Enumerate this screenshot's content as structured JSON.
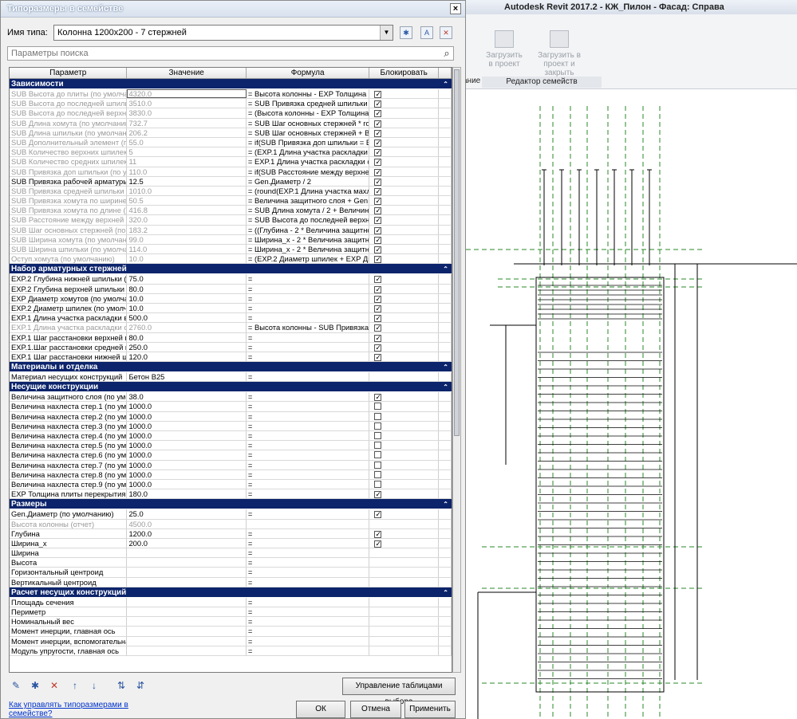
{
  "dialog": {
    "title": "Типоразмеры в семействе",
    "close": "×",
    "type_name_label": "Имя типа:",
    "type_name_value": "Колонна 1200х200 - 7 стержней",
    "search_placeholder": "Параметры поиска",
    "columns": [
      "Параметр",
      "Значение",
      "Формула",
      "Блокировать"
    ],
    "groups": [
      {
        "name": "Зависимости",
        "rows": [
          {
            "p": "SUB Высота до плиты (по умолчан",
            "v": "4320.0",
            "f": "= Высота колонны - EXP Толщина пл",
            "lock": "checked",
            "dim": true,
            "edit": true
          },
          {
            "p": "SUB Высота до последней  шпильк",
            "v": "3510.0",
            "f": "= SUB Привязка средней шпильки +",
            "lock": "checked",
            "dim": true
          },
          {
            "p": "SUB Высота до последней верхней",
            "v": "3830.0",
            "f": "= (Высота колонны - EXP Толщина пл",
            "lock": "checked",
            "dim": true
          },
          {
            "p": "SUB Длина хомута (по умолчанию)",
            "v": "732.7",
            "f": "= SUB Шаг основных стержней * rou",
            "lock": "checked",
            "dim": true
          },
          {
            "p": "SUB Длина шпильки (по умолчани",
            "v": "206.2",
            "f": "= SUB Шаг основных стержней + Вел",
            "lock": "checked",
            "dim": true
          },
          {
            "p": "SUB Дополнительный элемент (по",
            "v": "55.0",
            "f": "= if(SUB Привязка доп шпильки = EX",
            "lock": "checked",
            "dim": true
          },
          {
            "p": "SUB Количество верхних шпилек (",
            "v": "5",
            "f": "= (EXP.1 Длина участка раскладки в",
            "lock": "checked",
            "dim": true
          },
          {
            "p": "SUB Количество средних шпилек (",
            "v": "11",
            "f": "= EXP.1 Длина участка раскладки ср",
            "lock": "checked",
            "dim": true
          },
          {
            "p": "SUB Привязка доп шпильки (по умо",
            "v": "110.0",
            "f": "= if(SUB Расстояние между верхней",
            "lock": "checked",
            "dim": true
          },
          {
            "p": "SUB Привязка рабочей арматуры (",
            "v": "12.5",
            "f": "= Gen.Диаметр / 2",
            "lock": "checked",
            "dim": false
          },
          {
            "p": "SUB Привязка средней шпильки (п",
            "v": "1010.0",
            "f": "= (round(EXP.1 Длина участка махле",
            "lock": "checked",
            "dim": true
          },
          {
            "p": "SUB Привязка хомута по ширине (п",
            "v": "50.5",
            "f": "= Величина защитного слоя + Gen.Д",
            "lock": "checked",
            "dim": true
          },
          {
            "p": "SUB Привязка хомута по длине (по",
            "v": "416.8",
            "f": "= SUB Длина хомута / 2 + Величина з",
            "lock": "checked",
            "dim": true
          },
          {
            "p": "SUB Расстояние между верхней и с",
            "v": "320.0",
            "f": "= SUB Высота до последней верхней",
            "lock": "checked",
            "dim": true
          },
          {
            "p": "SUB Шаг основных стержней (по у",
            "v": "183.2",
            "f": "= ((Глубина - 2 * Величина защитног",
            "lock": "checked",
            "dim": true
          },
          {
            "p": "SUB Ширина хомута (по умолчани",
            "v": "99.0",
            "f": "= Ширина_х - 2 * Величина защитно",
            "lock": "checked",
            "dim": true
          },
          {
            "p": "SUB Ширина шпильки (по умолчан",
            "v": "114.0",
            "f": "= Ширина_х - 2 * Величина защитно",
            "lock": "checked",
            "dim": true
          },
          {
            "p": "Оступ.хомута (по умолчанию)",
            "v": "10.0",
            "f": "= (EXP.2 Диаметр шпилек + EXP Диа",
            "lock": "checked",
            "dim": true
          }
        ]
      },
      {
        "name": "Набор арматурных стержней",
        "rows": [
          {
            "p": "EXP.2 Глубина нижней шпильки (п",
            "v": "75.0",
            "f": "=",
            "lock": "checked",
            "dim": false
          },
          {
            "p": "EXP.2 Глубина верхней шпильки (п",
            "v": "80.0",
            "f": "=",
            "lock": "checked",
            "dim": false
          },
          {
            "p": "EXP Диаметр хомутов (по умолчан",
            "v": "10.0",
            "f": "=",
            "lock": "checked",
            "dim": false
          },
          {
            "p": "EXP.2 Диаметр шпилек (по умолча",
            "v": "10.0",
            "f": "=",
            "lock": "checked",
            "dim": false
          },
          {
            "p": "EXP.1 Длина участка раскладки ве",
            "v": "500.0",
            "f": "=",
            "lock": "checked",
            "dim": false
          },
          {
            "p": "EXP.1 Длина участка раскладки ср",
            "v": "2760.0",
            "f": "= Высота колонны - SUB Привязка ср",
            "lock": "checked",
            "dim": true
          },
          {
            "p": "EXP.1 Шаг расстановки верхней ш",
            "v": "80.0",
            "f": "=",
            "lock": "checked",
            "dim": false
          },
          {
            "p": "EXP.1.Шаг расстановки средней ш",
            "v": "250.0",
            "f": "=",
            "lock": "checked",
            "dim": false
          },
          {
            "p": "EXP.1 Шаг расстановки нижней шп",
            "v": "120.0",
            "f": "=",
            "lock": "checked",
            "dim": false
          }
        ]
      },
      {
        "name": "Материалы и отделка",
        "rows": [
          {
            "p": "Материал несущих конструкций",
            "v": "Бетон B25",
            "f": "=",
            "lock": "none",
            "dim": false
          }
        ]
      },
      {
        "name": "Несущие конструкции",
        "rows": [
          {
            "p": "Величина защитного слоя (по умол",
            "v": "38.0",
            "f": "=",
            "lock": "checked",
            "dim": false
          },
          {
            "p": "Величина нахлеста стер.1 (по умо",
            "v": "1000.0",
            "f": "=",
            "lock": "empty",
            "dim": false
          },
          {
            "p": "Величина нахлеста стер.2 (по умо",
            "v": "1000.0",
            "f": "=",
            "lock": "empty",
            "dim": false
          },
          {
            "p": "Величина нахлеста стер.3 (по умо",
            "v": "1000.0",
            "f": "=",
            "lock": "empty",
            "dim": false
          },
          {
            "p": "Величина нахлеста стер.4 (по умо",
            "v": "1000.0",
            "f": "=",
            "lock": "empty",
            "dim": false
          },
          {
            "p": "Величина нахлеста стер.5 (по умо",
            "v": "1000.0",
            "f": "=",
            "lock": "empty",
            "dim": false
          },
          {
            "p": "Величина нахлеста стер.6 (по умо",
            "v": "1000.0",
            "f": "=",
            "lock": "empty",
            "dim": false
          },
          {
            "p": "Величина нахлеста стер.7 (по умо",
            "v": "1000.0",
            "f": "=",
            "lock": "empty",
            "dim": false
          },
          {
            "p": "Величина нахлеста стер.8 (по умо",
            "v": "1000.0",
            "f": "=",
            "lock": "empty",
            "dim": false
          },
          {
            "p": "Величина нахлеста стер.9 (по умо",
            "v": "1000.0",
            "f": "=",
            "lock": "empty",
            "dim": false
          },
          {
            "p": "EXP Толщина плиты перекрытия (п",
            "v": "180.0",
            "f": "=",
            "lock": "checked",
            "dim": false
          }
        ]
      },
      {
        "name": "Размеры",
        "rows": [
          {
            "p": "Gen.Диаметр (по умолчанию)",
            "v": "25.0",
            "f": "=",
            "lock": "checked",
            "dim": false
          },
          {
            "p": "Высота колонны (отчет)",
            "v": "4500.0",
            "f": "",
            "lock": "none",
            "dim": true
          },
          {
            "p": "Глубина",
            "v": "1200.0",
            "f": "=",
            "lock": "checked",
            "dim": false
          },
          {
            "p": "Ширина_х",
            "v": "200.0",
            "f": "=",
            "lock": "checked",
            "dim": false
          },
          {
            "p": "Ширина",
            "v": "",
            "f": "=",
            "lock": "none",
            "dim": false
          },
          {
            "p": "Высота",
            "v": "",
            "f": "=",
            "lock": "none",
            "dim": false
          },
          {
            "p": "Горизонтальный центроид",
            "v": "",
            "f": "=",
            "lock": "none",
            "dim": false
          },
          {
            "p": "Вертикальный центроид",
            "v": "",
            "f": "=",
            "lock": "none",
            "dim": false
          }
        ]
      },
      {
        "name": "Расчет несущих конструкций",
        "rows": [
          {
            "p": "Площадь сечения",
            "v": "",
            "f": "=",
            "lock": "none",
            "dim": false
          },
          {
            "p": "Периметр",
            "v": "",
            "f": "=",
            "lock": "none",
            "dim": false
          },
          {
            "p": "Номинальный вес",
            "v": "",
            "f": "=",
            "lock": "none",
            "dim": false
          },
          {
            "p": "Момент инерции, главная ось",
            "v": "",
            "f": "=",
            "lock": "none",
            "dim": false
          },
          {
            "p": "Момент инерции, вспомогательная",
            "v": "",
            "f": "=",
            "lock": "none",
            "dim": false
          },
          {
            "p": "Модуль упругости, главная ось",
            "v": "",
            "f": "=",
            "lock": "none",
            "dim": false
          }
        ]
      }
    ],
    "manage_lookup_button": "Управление таблицами выбора",
    "help_link": "Как управлять типоразмерами в семействе?",
    "ok": "ОК",
    "cancel": "Отмена",
    "apply": "Применить"
  },
  "revit": {
    "title": "Autodesk Revit 2017.2 -    КЖ_Пилон - Фасад: Справа",
    "load_into_project": "Загрузить в проект",
    "load_and_close": "Загрузить в проект и закрыть",
    "group_label": "Редактор семейств",
    "left_group_fragment": "ание"
  }
}
